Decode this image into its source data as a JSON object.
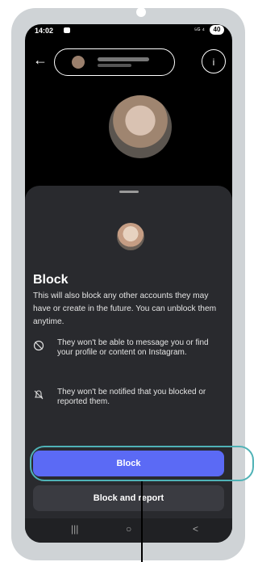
{
  "status_bar": {
    "time": "14:02",
    "signal": "⁵ᴳ ⁴",
    "battery": "40"
  },
  "topbar": {
    "back_icon": "back-arrow-icon",
    "info_icon": "info-icon",
    "info_symbol": "i"
  },
  "profile": {
    "name": ""
  },
  "sheet": {
    "title": "Block",
    "description": "This will also block any other accounts they may have or create in the future. You can unblock them anytime.",
    "items": [
      {
        "icon": "no-message-icon",
        "text": "They won't be able to message you or find your profile or content on Instagram."
      },
      {
        "icon": "no-bell-icon",
        "text": "They won't be notified that you blocked or reported them."
      }
    ],
    "block_label": "Block",
    "block_report_label": "Block and report"
  },
  "navbar": {
    "recent": "|||",
    "home": "○",
    "back": "<"
  },
  "colors": {
    "accent": "#5b6af5",
    "highlight": "#4fb2b6",
    "sheet_bg": "#292a2e"
  }
}
